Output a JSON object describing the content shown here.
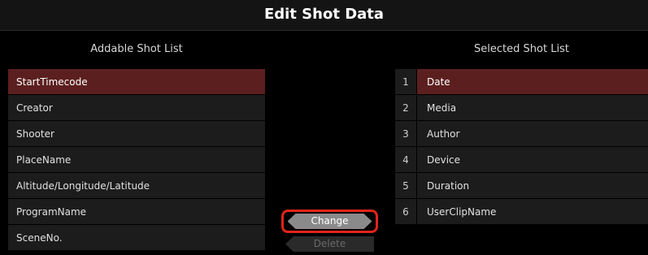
{
  "title": "Edit Shot Data",
  "left_panel": {
    "heading": "Addable Shot List",
    "items": [
      {
        "label": "StartTimecode",
        "selected": true
      },
      {
        "label": "Creator",
        "selected": false
      },
      {
        "label": "Shooter",
        "selected": false
      },
      {
        "label": "PlaceName",
        "selected": false
      },
      {
        "label": "Altitude/Longitude/Latitude",
        "selected": false
      },
      {
        "label": "ProgramName",
        "selected": false
      },
      {
        "label": "SceneNo.",
        "selected": false
      }
    ]
  },
  "right_panel": {
    "heading": "Selected Shot List",
    "items": [
      {
        "index": "1",
        "label": "Date",
        "selected": true
      },
      {
        "index": "2",
        "label": "Media",
        "selected": false
      },
      {
        "index": "3",
        "label": "Author",
        "selected": false
      },
      {
        "index": "4",
        "label": "Device",
        "selected": false
      },
      {
        "index": "5",
        "label": "Duration",
        "selected": false
      },
      {
        "index": "6",
        "label": "UserClipName",
        "selected": false
      }
    ]
  },
  "buttons": {
    "change_label": "Change",
    "delete_label": "Delete",
    "highlight_color": "#e0241c"
  },
  "colors": {
    "selected_row": "#5c1f1f",
    "row": "#1c1c1c",
    "background": "#000000"
  }
}
